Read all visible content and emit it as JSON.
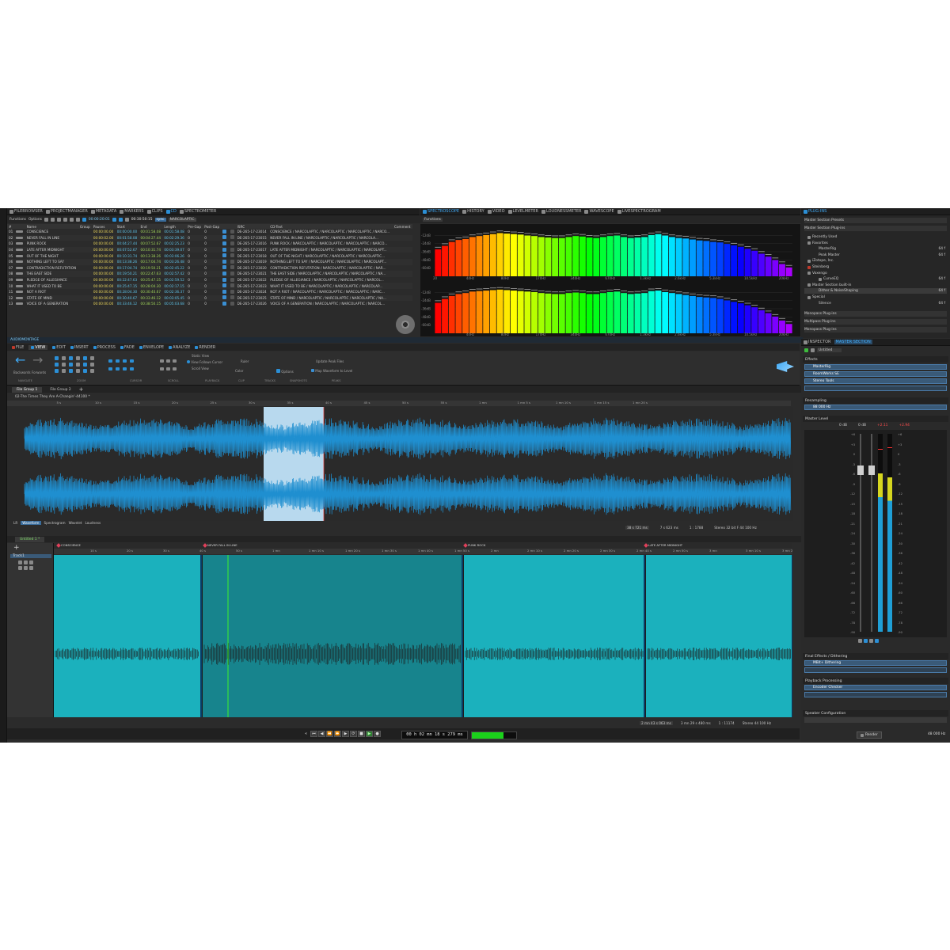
{
  "toptabs": {
    "filebrowser": "FILEBROWSER",
    "projectmanager": "PROJECTMANAGER",
    "metadata": "METADATA",
    "markers": "MARKERS",
    "clips": "CLIPS",
    "cd": "CD",
    "spectrometer": "SPECTROMETER"
  },
  "cd_toolbar": {
    "functions": "Functions",
    "options": "Options",
    "time1": "00:00:20:01",
    "time2": "00:30:50:15",
    "label": "NARCOLAPTIC",
    "badge": "sync"
  },
  "cd_table": {
    "headers": [
      "#",
      "",
      "Name",
      "Group",
      "Pauses",
      "Start",
      "End",
      "Length",
      "Pre-Gap",
      "Post-Gap",
      "",
      "",
      "ISRC",
      "CD-Text",
      "Comment"
    ],
    "rows": [
      {
        "n": "01",
        "name": "CONSCIENCE",
        "pauses": "00:00:00.00",
        "start": "00:00:00.00",
        "end": "00:01:58.08",
        "len": "00:01:58.08",
        "pre": "0",
        "post": "0",
        "isrc": "DE-265-17-23014",
        "text": "CONSCIENCE / NARCOLAPTIC / NARCOLAPTIC / NARCOLAPTIC / NARCO..."
      },
      {
        "n": "02",
        "name": "NEVER FALL IN LINE",
        "pauses": "00:00:02.00",
        "start": "00:01:58.08",
        "end": "00:04:27.44",
        "len": "00:02:29.36",
        "pre": "0",
        "post": "0",
        "isrc": "DE-265-17-23015",
        "text": "NEVER FALL IN LINE / NARCOLAPTIC / NARCOLAPTIC / NARCOLA..."
      },
      {
        "n": "03",
        "name": "PUNK ROCK",
        "pauses": "00:00:00.00",
        "start": "00:04:27.44",
        "end": "00:07:52.67",
        "len": "00:02:25.23",
        "pre": "0",
        "post": "0",
        "isrc": "DE-265-17-23016",
        "text": "PUNK ROCK / NARCOLAPTIC / NARCOLAPTIC / NARCOLAPTIC / NARCO..."
      },
      {
        "n": "04",
        "name": "LATE AFTER MIDNIGHT",
        "pauses": "00:00:00.00",
        "start": "00:07:52.67",
        "end": "00:10:31.74",
        "len": "00:03:39.07",
        "pre": "0",
        "post": "0",
        "isrc": "DE-265-17-23017",
        "text": "LATE AFTER MIDNIGHT / NARCOLAPTIC / NARCOLAPTIC / NARCOLAPT..."
      },
      {
        "n": "05",
        "name": "OUT OF THE NIGHT",
        "pauses": "00:00:00.00",
        "start": "00:10:31.74",
        "end": "00:13:38.26",
        "len": "00:03:06.26",
        "pre": "0",
        "post": "0",
        "isrc": "DE-265-17-23018",
        "text": "OUT OF THE NIGHT / NARCOLAPTIC / NARCOLAPTIC / NARCOLAPTIC..."
      },
      {
        "n": "06",
        "name": "NOTHING LEFT TO SAY",
        "pauses": "00:00:00.00",
        "start": "00:13:38.26",
        "end": "00:17:04.74",
        "len": "00:03:26.48",
        "pre": "0",
        "post": "0",
        "isrc": "DE-265-17-23019",
        "text": "NOTHING LEFT TO SAY / NARCOLAPTIC / NARCOLAPTIC / NARCOLAPT..."
      },
      {
        "n": "07",
        "name": "CONTRADICTION REFUTATION",
        "pauses": "00:00:00.00",
        "start": "00:17:04.74",
        "end": "00:19:50.21",
        "len": "00:02:45.22",
        "pre": "0",
        "post": "0",
        "isrc": "DE-265-17-23020",
        "text": "CONTRADICTION REFUTATION / NARCOLAPTIC / NARCOLAPTIC / NAR..."
      },
      {
        "n": "08",
        "name": "THE EAST SIDE",
        "pauses": "00:00:00.00",
        "start": "00:19:50.21",
        "end": "00:22:47.63",
        "len": "00:02:57.42",
        "pre": "0",
        "post": "0",
        "isrc": "DE-265-17-23021",
        "text": "THE EAST SIDE / NARCOLAPTIC / NARCOLAPTIC / NARCOLAPTIC / NA..."
      },
      {
        "n": "09",
        "name": "PLEDGE OF ALLEGIANCE",
        "pauses": "00:00:00.00",
        "start": "00:22:47.63",
        "end": "00:25:47.15",
        "len": "00:02:59.52",
        "pre": "0",
        "post": "0",
        "isrc": "DE-265-17-23022",
        "text": "PLEDGE OF ALLEGIANCE / NARCOLAPTIC / NARCOLAPTIC / NARCOL..."
      },
      {
        "n": "10",
        "name": "WHAT IT USED TO BE",
        "pauses": "00:00:00.00",
        "start": "00:25:47.15",
        "end": "00:28:04.30",
        "len": "00:02:17.15",
        "pre": "0",
        "post": "0",
        "isrc": "DE-265-17-23023",
        "text": "WHAT IT USED TO BE / NARCOLAPTIC / NARCOLAPTIC / NARCOLAP..."
      },
      {
        "n": "11",
        "name": "NOT A RIOT",
        "pauses": "00:00:00.00",
        "start": "00:28:04.30",
        "end": "00:30:40.67",
        "len": "00:02:36.37",
        "pre": "0",
        "post": "0",
        "isrc": "DE-265-17-23024",
        "text": "NOT A RIOT / NARCOLAPTIC / NARCOLAPTIC / NARCOLAPTIC / NARC..."
      },
      {
        "n": "12",
        "name": "STATE OF MIND",
        "pauses": "00:00:00.00",
        "start": "00:30:40.67",
        "end": "00:33:46.12",
        "len": "00:03:05.45",
        "pre": "0",
        "post": "0",
        "isrc": "DE-265-17-23025",
        "text": "STATE OF MIND / NARCOLAPTIC / NARCOLAPTIC / NARCOLAPTIC / NA..."
      },
      {
        "n": "13",
        "name": "VOICE OF A GENERATION",
        "pauses": "00:00:00.00",
        "start": "00:33:46.12",
        "end": "00:38:50.15",
        "len": "00:05:03.68",
        "pre": "0",
        "post": "0",
        "isrc": "DE-265-17-23026",
        "text": "VOICE OF A GENERATION / NARCOLAPTIC / NARCOLAPTIC / NARCOL..."
      }
    ]
  },
  "spectro_tabs": {
    "spectroscope": "SPECTROSCOPE",
    "history": "HISTORY",
    "video": "VIDEO",
    "levelmeter": "LEVELMETER",
    "loudnessmeter": "LOUDNESSMETER",
    "wavescope": "WAVESCOPE",
    "livespectrogram": "LIVESPECTROGRAM"
  },
  "spectro": {
    "functions": "Functions",
    "db_labels": [
      "-12dB",
      "-24dB",
      "-36dB",
      "-48dB",
      "-60dB"
    ],
    "freq_labels": [
      "44Hz",
      "80Hz",
      "170Hz",
      "340Hz",
      "670Hz",
      "1.3kHz",
      "2.6kHz",
      "5.3kHz",
      "10.5kHz",
      "20kHz"
    ],
    "freq_min": "20",
    "levels_top": [
      0.55,
      0.62,
      0.7,
      0.74,
      0.76,
      0.8,
      0.82,
      0.84,
      0.86,
      0.88,
      0.87,
      0.86,
      0.85,
      0.83,
      0.82,
      0.8,
      0.79,
      0.78,
      0.78,
      0.8,
      0.82,
      0.81,
      0.79,
      0.78,
      0.8,
      0.82,
      0.83,
      0.8,
      0.78,
      0.79,
      0.8,
      0.84,
      0.86,
      0.83,
      0.8,
      0.78,
      0.77,
      0.75,
      0.73,
      0.72,
      0.7,
      0.69,
      0.66,
      0.63,
      0.6,
      0.56,
      0.52,
      0.46,
      0.4,
      0.33,
      0.25,
      0.18
    ],
    "levels_bottom": [
      0.62,
      0.7,
      0.76,
      0.8,
      0.82,
      0.85,
      0.86,
      0.87,
      0.88,
      0.89,
      0.88,
      0.87,
      0.86,
      0.85,
      0.84,
      0.82,
      0.81,
      0.8,
      0.8,
      0.82,
      0.83,
      0.82,
      0.8,
      0.8,
      0.82,
      0.84,
      0.85,
      0.82,
      0.8,
      0.81,
      0.82,
      0.86,
      0.87,
      0.84,
      0.82,
      0.8,
      0.78,
      0.76,
      0.74,
      0.73,
      0.72,
      0.7,
      0.67,
      0.64,
      0.61,
      0.57,
      0.53,
      0.47,
      0.41,
      0.34,
      0.26,
      0.19
    ]
  },
  "plugins": {
    "title": "PLUG-INS",
    "header1": "Master Section Presets",
    "header2": "Master Section Plug-ins",
    "items": [
      {
        "label": "Recently Used",
        "size": ""
      },
      {
        "label": "Favorites",
        "size": ""
      },
      {
        "label": "MasterRig",
        "size": "64 f"
      },
      {
        "label": "Peak Master",
        "size": "64 f"
      },
      {
        "label": "iZotope, Inc.",
        "size": ""
      },
      {
        "label": "Steinberg",
        "size": ""
      },
      {
        "label": "Voxengo",
        "size": ""
      },
      {
        "label": "CurveEQ",
        "size": "64 f"
      },
      {
        "label": "Master Section built-in",
        "size": ""
      },
      {
        "label": "Dither & NoiseShaping",
        "size": "64 f"
      },
      {
        "label": "Special",
        "size": ""
      },
      {
        "label": "Silence",
        "size": "64 f"
      }
    ],
    "mono": "Monopass Plug-ins",
    "multi": "Multipass Plug-ins",
    "mono2": "Monopass Plug-ins"
  },
  "audiomontage_title": "AUDIOMONTAGE",
  "ribbon": {
    "tabs": [
      "FILE",
      "VIEW",
      "EDIT",
      "INSERT",
      "PROCESS",
      "FADE",
      "ENVELOPE",
      "ANALYZE",
      "RENDER"
    ],
    "backwards": "Backwards",
    "forwards": "Forwards",
    "groups": [
      "NAVIGATE",
      "ZOOM",
      "CURSOR",
      "SCROLL",
      "PLAYBACK",
      "CLIP",
      "TRACKS",
      "SNAPSHOTS",
      "PEAKS"
    ],
    "static_view": "Static View",
    "follows": "View Follows Cursor",
    "scroll_view": "Scroll View",
    "ruler": "Ruler",
    "color": "Color",
    "options": "Options",
    "update_peak": "Update Peak Files",
    "map_wave": "Map Waveform to Level"
  },
  "filegroups": {
    "g1": "File Group 1",
    "g2": "File Group 2"
  },
  "wave_title": "02-The Times They Are A-Changin'-44100 *",
  "wave_ruler": [
    "5 s",
    "10 s",
    "15 s",
    "20 s",
    "25 s",
    "30 s",
    "35 s",
    "40 s",
    "45 s",
    "50 s",
    "55 s",
    "1 mn",
    "1 mn 5 s",
    "1 mn 10 s",
    "1 mn 15 s",
    "1 mn 20 s"
  ],
  "wave_tabs": {
    "lr": "LR",
    "waveform": "Waveform",
    "spectrogram": "Spectrogram",
    "wavelet": "Wavelet",
    "loudness": "Loudness"
  },
  "wave_status": {
    "pos": "38 s 721 ms",
    "len": "7 s 623 ms",
    "zoom": "1 : 1788",
    "format": "Stereo 32 bit F 44 100 Hz"
  },
  "montage": {
    "title": "Untitled 1 *",
    "track": "Track1",
    "markers": [
      "CONSCIENCE",
      "NEVER FALL IN LINE",
      "PUNK ROCK",
      "LATE AFTER MIDNIGHT"
    ],
    "ruler": [
      "10 s",
      "20 s",
      "30 s",
      "40 s",
      "50 s",
      "1 mn",
      "1 mn 10 s",
      "1 mn 20 s",
      "1 mn 30 s",
      "1 mn 40 s",
      "1 mn 50 s",
      "2 mn",
      "2 mn 10 s",
      "2 mn 20 s",
      "2 mn 30 s",
      "2 mn 40 s",
      "2 mn 50 s",
      "3 mn",
      "3 mn 10 s",
      "3 mn 20 s"
    ],
    "status": {
      "pos": "2 mn 43 s 063 ms",
      "len": "3 mn 29 s 480 ms",
      "zoom": "1 : 11174",
      "format": "Stereo 44 100 Hz"
    }
  },
  "transport": {
    "time": "00 h 02 mn 18 s 279 ms",
    "level": 0.72
  },
  "inspector": {
    "tab1": "INSPECTOR",
    "tab2": "MASTER SECTION",
    "preset": "Untitled",
    "effects": "Effects",
    "slots": [
      "MasterRig",
      "RoomWorks SE",
      "Stereo Tools"
    ],
    "resampling": "Resampling",
    "rate": "88 000 Hz",
    "master_level": "Master Level",
    "db_left": "0 dB",
    "db_right": "0 dB",
    "peak_left": "+2.11",
    "peak_right": "+2.94",
    "scale": [
      "+6",
      "+3",
      "0",
      "-3",
      "-6",
      "-9",
      "-12",
      "-15",
      "-18",
      "-21",
      "-24",
      "-30",
      "-36",
      "-42",
      "-48",
      "-54",
      "-60",
      "-66",
      "-72",
      "-78",
      "-90"
    ],
    "meter_left": 0.8,
    "meter_right": 0.78,
    "final": "Final Effects / Dithering",
    "mbit": "MBit+ Dithering",
    "playback": "Playback Processing",
    "encoder": "Encoder Checker",
    "speaker": "Speaker Configuration",
    "render": "Render",
    "rate_out": "48 000 Hz"
  }
}
